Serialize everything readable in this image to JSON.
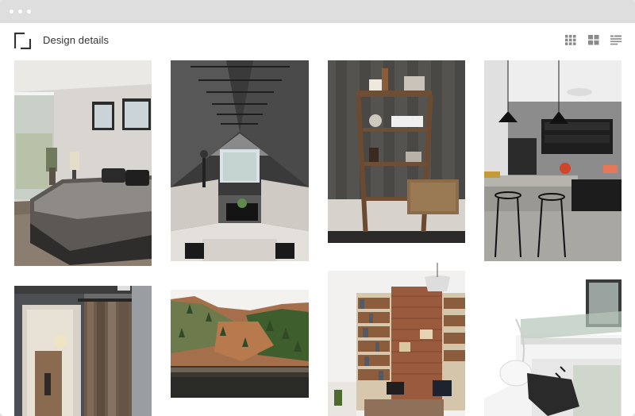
{
  "window": {
    "title_bar_dots": 3,
    "background": "#e3e3e3"
  },
  "header": {
    "title": "Design details",
    "logo_icon": "frame-corner-icon",
    "view_buttons": [
      {
        "name": "grid-small-view",
        "icon": "grid-small-icon",
        "active": false
      },
      {
        "name": "grid-large-view",
        "icon": "grid-large-icon",
        "active": false
      },
      {
        "name": "list-view",
        "icon": "list-view-icon",
        "active": false
      }
    ]
  },
  "gallery": {
    "columns": 4,
    "items": [
      {
        "subject": "bedroom",
        "column": 1
      },
      {
        "subject": "barn-door-hallway",
        "column": 1
      },
      {
        "subject": "attic-living-room",
        "column": 2
      },
      {
        "subject": "hillside-landscape",
        "column": 2
      },
      {
        "subject": "ladder-shelf",
        "column": 3
      },
      {
        "subject": "library-brick-wall",
        "column": 3
      },
      {
        "subject": "concrete-kitchen",
        "column": 4
      },
      {
        "subject": "modern-staircase",
        "column": 4
      }
    ]
  },
  "colors": {
    "icon": "#333333",
    "view_icon": "#8a8a8a",
    "text": "#333333"
  }
}
